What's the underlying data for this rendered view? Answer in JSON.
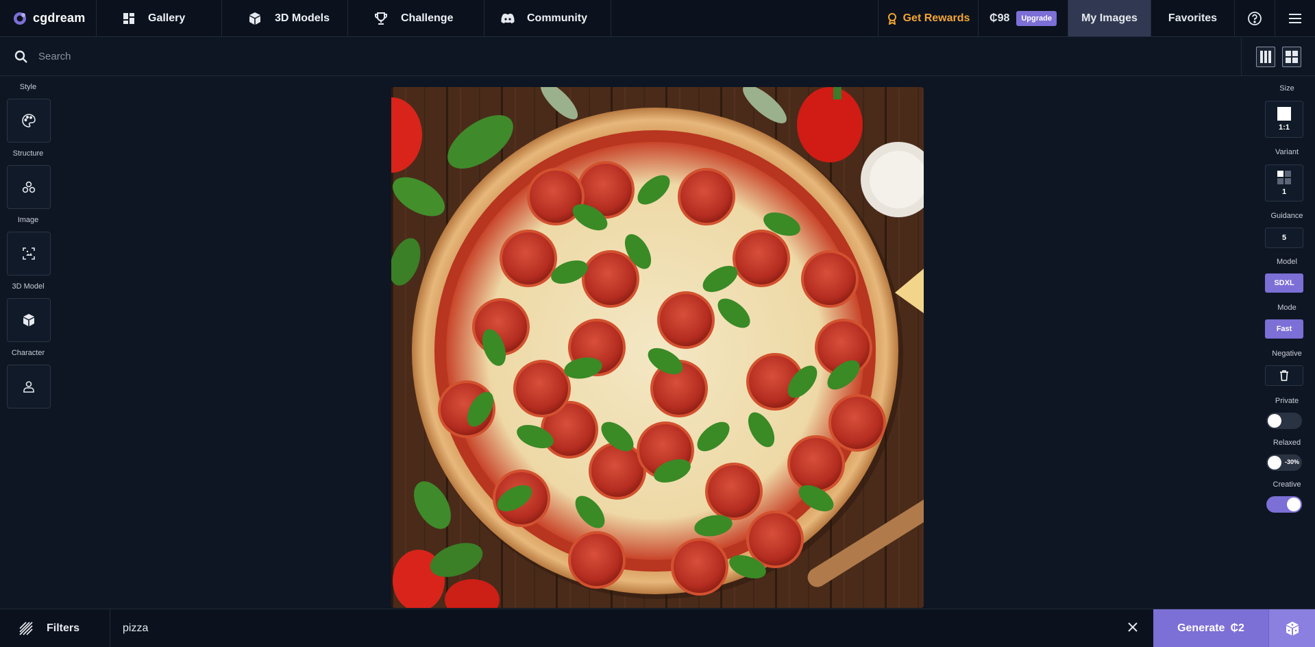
{
  "header": {
    "logo_text": "cgdream",
    "nav": [
      {
        "label": "Gallery",
        "icon": "grid-icon"
      },
      {
        "label": "3D Models",
        "icon": "cube-icon"
      },
      {
        "label": "Challenge",
        "icon": "trophy-icon"
      },
      {
        "label": "Community",
        "icon": "discord-icon"
      }
    ],
    "rewards_label": "Get Rewards",
    "credits": "98",
    "upgrade_label": "Upgrade",
    "my_images_label": "My Images",
    "favorites_label": "Favorites"
  },
  "search": {
    "placeholder": "Search"
  },
  "left_panel": {
    "items": [
      {
        "label": "Style",
        "icon": "palette-icon"
      },
      {
        "label": "Structure",
        "icon": "structure-icon"
      },
      {
        "label": "Image",
        "icon": "image-scan-icon"
      },
      {
        "label": "3D Model",
        "icon": "cube-icon"
      },
      {
        "label": "Character",
        "icon": "person-icon"
      }
    ]
  },
  "right_panel": {
    "size_label": "Size",
    "size_value": "1:1",
    "variant_label": "Variant",
    "variant_value": "1",
    "guidance_label": "Guidance",
    "guidance_value": "5",
    "model_label": "Model",
    "model_value": "SDXL",
    "mode_label": "Mode",
    "mode_value": "Fast",
    "negative_label": "Negative",
    "private_label": "Private",
    "private_on": false,
    "relaxed_label": "Relaxed",
    "relaxed_tag": "-30%",
    "relaxed_on": false,
    "creative_label": "Creative",
    "creative_on": true
  },
  "bottom": {
    "filters_label": "Filters",
    "prompt_value": "pizza",
    "generate_label": "Generate",
    "generate_cost": "2"
  },
  "colors": {
    "accent": "#7c6fd6",
    "rewards": "#f3a533",
    "background": "#0e1623"
  }
}
